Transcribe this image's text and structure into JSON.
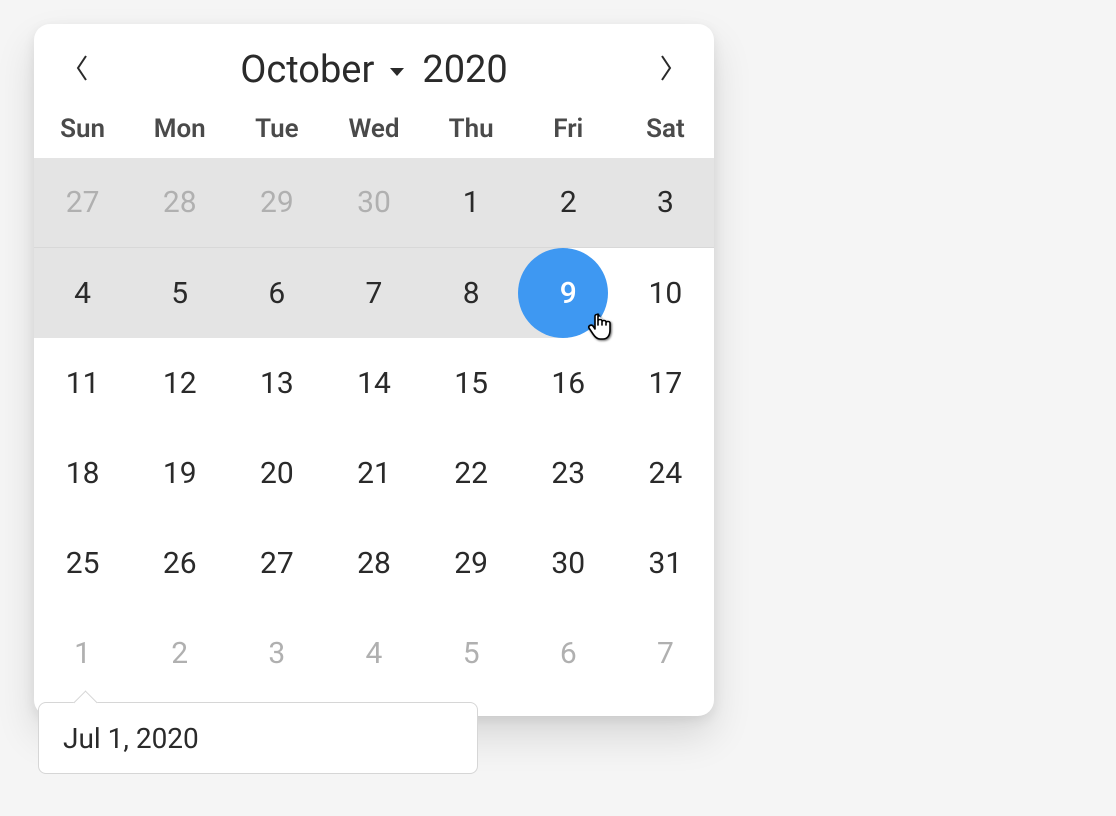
{
  "header": {
    "month_label": "October",
    "year_label": "2020"
  },
  "dow": [
    "Sun",
    "Mon",
    "Tue",
    "Wed",
    "Thu",
    "Fri",
    "Sat"
  ],
  "weeks": [
    {
      "range": "full",
      "cells": [
        {
          "n": "27",
          "other": true,
          "range": true
        },
        {
          "n": "28",
          "other": true,
          "range": true
        },
        {
          "n": "29",
          "other": true,
          "range": true
        },
        {
          "n": "30",
          "other": true,
          "range": true
        },
        {
          "n": "1",
          "range": true
        },
        {
          "n": "2",
          "range": true
        },
        {
          "n": "3",
          "range": true
        }
      ]
    },
    {
      "range": "partial",
      "cells": [
        {
          "n": "4",
          "range": true
        },
        {
          "n": "5",
          "range": true
        },
        {
          "n": "6",
          "range": true
        },
        {
          "n": "7",
          "range": true
        },
        {
          "n": "8",
          "range": true
        },
        {
          "n": "9",
          "range": true,
          "hovered": true,
          "range_end": true
        },
        {
          "n": "10"
        }
      ]
    },
    {
      "cells": [
        {
          "n": "11"
        },
        {
          "n": "12"
        },
        {
          "n": "13"
        },
        {
          "n": "14"
        },
        {
          "n": "15"
        },
        {
          "n": "16"
        },
        {
          "n": "17"
        }
      ]
    },
    {
      "cells": [
        {
          "n": "18"
        },
        {
          "n": "19"
        },
        {
          "n": "20"
        },
        {
          "n": "21"
        },
        {
          "n": "22"
        },
        {
          "n": "23"
        },
        {
          "n": "24"
        }
      ]
    },
    {
      "cells": [
        {
          "n": "25"
        },
        {
          "n": "26"
        },
        {
          "n": "27"
        },
        {
          "n": "28"
        },
        {
          "n": "29"
        },
        {
          "n": "30"
        },
        {
          "n": "31"
        }
      ]
    },
    {
      "cells": [
        {
          "n": "1",
          "other": true
        },
        {
          "n": "2",
          "other": true
        },
        {
          "n": "3",
          "other": true
        },
        {
          "n": "4",
          "other": true
        },
        {
          "n": "5",
          "other": true
        },
        {
          "n": "6",
          "other": true
        },
        {
          "n": "7",
          "other": true
        }
      ]
    }
  ],
  "input_value": "Jul 1, 2020",
  "colors": {
    "hover": "#3e98f2",
    "range": "#e4e4e4",
    "muted": "#b0b0b0"
  }
}
